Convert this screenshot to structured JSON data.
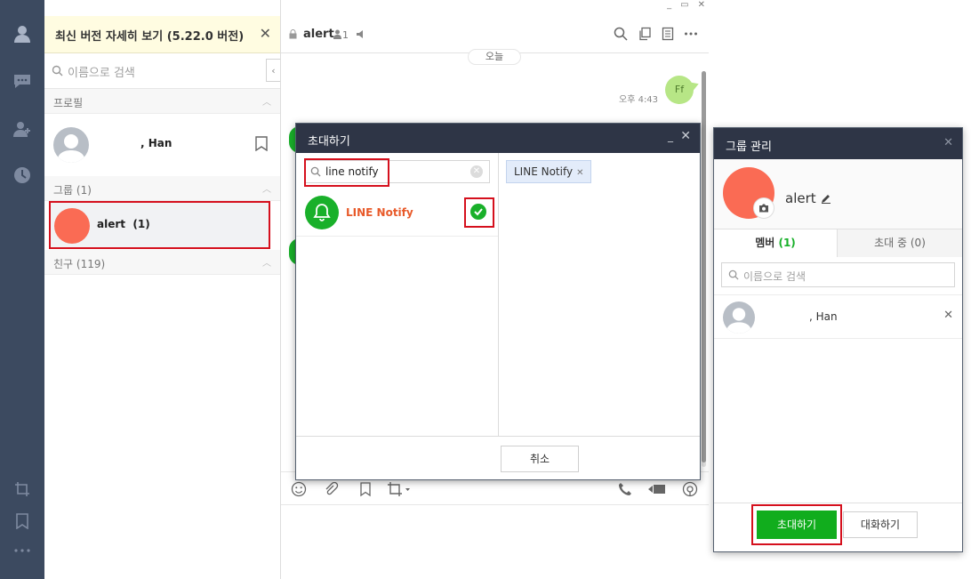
{
  "notice": {
    "text": "최신 버전 자세히 보기 (5.22.0 버전)",
    "close": "✕"
  },
  "list": {
    "search_placeholder": "이름으로 검색",
    "collapse": "‹",
    "sections": {
      "profile": "프로필",
      "groups": "그룹 (1)",
      "friends": "친구 (119)"
    },
    "profile_name": ", Han",
    "group": {
      "name": "alert",
      "count": "(1)"
    }
  },
  "chat": {
    "title": "alert",
    "member_count": "1",
    "date_pill": "오늘",
    "message_text": "Ff",
    "message_time": "오후 4:43",
    "window_controls": [
      "_",
      "▭",
      "✕"
    ]
  },
  "invite": {
    "title": "초대하기",
    "min": "_",
    "close": "✕",
    "search_value": "line notify",
    "clear": "✕",
    "result_name": "LINE Notify",
    "selected_chip": "LINE Notify",
    "chip_remove": "✕",
    "cancel_label": "취소"
  },
  "group_manage": {
    "title": "그룹 관리",
    "close": "✕",
    "group_name": "alert",
    "tab_members": "멤버",
    "tab_members_count": "(1)",
    "tab_invited": "초대 중 (0)",
    "search_placeholder": "이름으로 검색",
    "member_name": ", Han",
    "member_remove": "✕",
    "invite_button": "초대하기",
    "chat_button": "대화하기"
  },
  "colors": {
    "sidebar": "#3c4a60",
    "dialog_header": "#2e3546",
    "line_green": "#19b02a",
    "group_avatar": "#fa6b54",
    "highlight_red": "#d5101d",
    "notify_orange": "#e85a2a"
  },
  "icons": [
    "person-icon",
    "chat-bubble-icon",
    "add-friend-icon",
    "clock-icon",
    "crop-icon",
    "bookmark-icon",
    "more-icon",
    "search-icon",
    "lock-icon",
    "speaker-icon",
    "copy-icon",
    "notes-icon",
    "emoji-icon",
    "attach-icon",
    "phone-icon",
    "video-icon",
    "bell-icon",
    "check-icon",
    "camera-icon",
    "edit-icon"
  ]
}
